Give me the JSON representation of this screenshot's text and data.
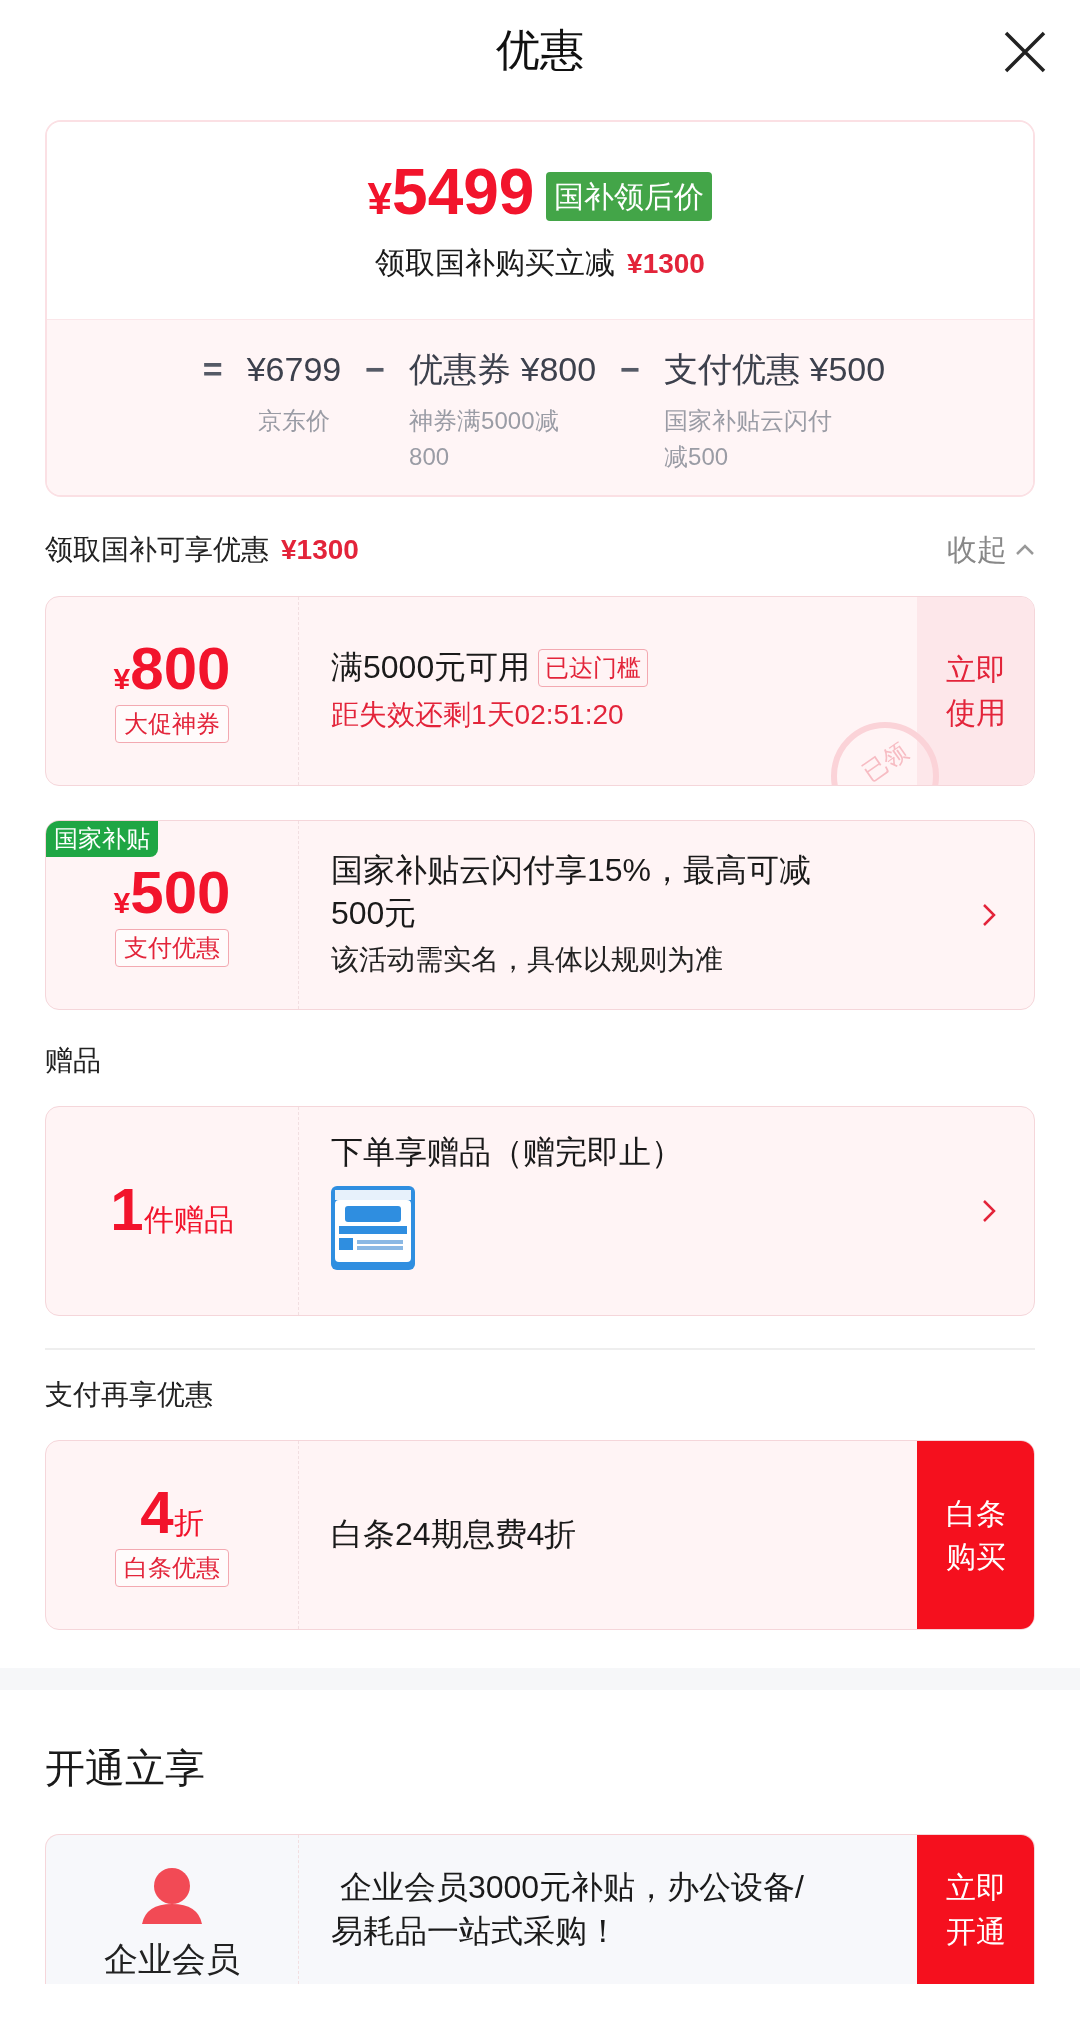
{
  "header": {
    "title": "优惠"
  },
  "summary": {
    "currency": "¥",
    "price": "5499",
    "price_tag": "国补领后价",
    "note": "领取国补购买立减",
    "note_amount": "¥1300",
    "breakdown": [
      {
        "operator": "=",
        "amount": "¥6799",
        "label": "京东价"
      },
      {
        "operator": "−",
        "amount": "优惠券 ¥800",
        "label": "神券满5000减800"
      },
      {
        "operator": "−",
        "amount": "支付优惠 ¥500",
        "label": "国家补贴云闪付减500"
      }
    ]
  },
  "sections": [
    {
      "title": "领取国补可享优惠",
      "title_amount": "¥1300",
      "toggle": "收起",
      "cards": [
        {
          "left": {
            "kind": "amount",
            "currency": "¥",
            "value": "800",
            "tag": "大促神券"
          },
          "title": "满5000元可用",
          "badge": "已达门槛",
          "subtitle": "距失效还剩1天02:51:20",
          "action": {
            "label": "立即使用",
            "filled": false
          },
          "stamp": "已领"
        },
        {
          "corner_tag": "国家补贴",
          "left": {
            "kind": "amount",
            "currency": "¥",
            "value": "500",
            "tag": "支付优惠"
          },
          "title": "国家补贴云闪付享15%，最高可减500元",
          "description": "该活动需实名，具体以规则为准",
          "chevron": true
        }
      ]
    },
    {
      "title": "赠品",
      "cards": [
        {
          "left": {
            "kind": "count",
            "value": "1",
            "unit": "件赠品"
          },
          "title": "下单享赠品（赠完即止）",
          "chevron": true
        }
      ]
    },
    {
      "title": "支付再享优惠",
      "divider": true,
      "cards": [
        {
          "left": {
            "kind": "count",
            "value": "4",
            "unit": "折",
            "tag": "白条优惠"
          },
          "title": "白条24期息费4折",
          "action": {
            "label": "白条购买",
            "filled": true
          }
        }
      ]
    }
  ],
  "open_section": {
    "title": "开通立享",
    "cards": [
      {
        "left": {
          "kind": "avatar",
          "label": "企业会员"
        },
        "title": " 企业会员3000元补贴，办公设备/易耗品一站式采购！",
        "action": {
          "label": "立即开通",
          "filled": true
        }
      }
    ]
  }
}
